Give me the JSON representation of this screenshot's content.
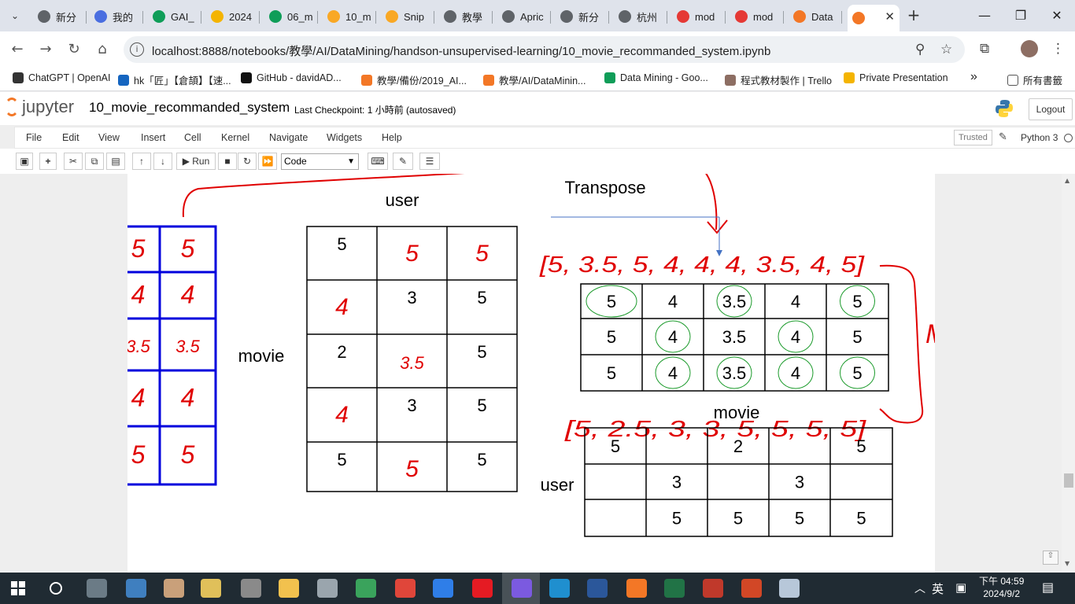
{
  "tabs": [
    {
      "label": "新分",
      "color": "#5f6368"
    },
    {
      "label": "我的",
      "color": "#4a6ee0"
    },
    {
      "label": "GAI_",
      "color": "#0f9d58"
    },
    {
      "label": "2024",
      "color": "#f4b400"
    },
    {
      "label": "06_m",
      "color": "#0f9d58"
    },
    {
      "label": "10_m",
      "color": "#f9a825"
    },
    {
      "label": "Snip",
      "color": "#f9a825"
    },
    {
      "label": "教學",
      "color": "#5f6368"
    },
    {
      "label": "Apric",
      "color": "#5f6368"
    },
    {
      "label": "新分",
      "color": "#5f6368"
    },
    {
      "label": "杭州",
      "color": "#5f6368"
    },
    {
      "label": "mod",
      "color": "#e53935"
    },
    {
      "label": "mod",
      "color": "#e53935"
    },
    {
      "label": "Data",
      "color": "#f37726"
    },
    {
      "label": "",
      "color": "#f37726"
    }
  ],
  "address": {
    "url": "localhost:8888/notebooks/教學/AI/DataMining/handson-unsupervised-learning/10_movie_recommanded_system.ipynb"
  },
  "bookmarks": [
    {
      "label": "ChatGPT | OpenAI",
      "color": "#333333"
    },
    {
      "label": "hk「匠」【倉頡】【速...",
      "color": "#1565c0"
    },
    {
      "label": "GitHub - davidAD...",
      "color": "#111111"
    },
    {
      "label": "教學/備份/2019_AI...",
      "color": "#f37726"
    },
    {
      "label": "教學/AI/DataMinin...",
      "color": "#f37726"
    },
    {
      "label": "Data Mining - Goo...",
      "color": "#0f9d58"
    },
    {
      "label": "程式教材製作 | Trello",
      "color": "#8d6e63"
    },
    {
      "label": "Private Presentation",
      "color": "#f4b400"
    }
  ],
  "bookmarks_all": "所有書籤",
  "jupyter": {
    "logo_text": "jupyter",
    "notebook_name": "10_movie_recommanded_system",
    "checkpoint": "Last Checkpoint: 1 小時前  (autosaved)",
    "logout": "Logout",
    "menu": [
      "File",
      "Edit",
      "View",
      "Insert",
      "Cell",
      "Kernel",
      "Navigate",
      "Widgets",
      "Help"
    ],
    "trusted": "Trusted",
    "kernel": "Python 3",
    "run_label": "Run",
    "cell_type": "Code"
  },
  "figure": {
    "user_top": "user",
    "movie_left": "movie",
    "transpose": "Transpose",
    "movie_mid": "movie",
    "user_left": "user",
    "mse": "MSE",
    "blue_grid": [
      [
        "5",
        "5",
        "5"
      ],
      [
        "4",
        "4",
        "4"
      ],
      [
        "3.5",
        "3.5",
        "3.5"
      ],
      [
        "4",
        "4",
        "4"
      ],
      [
        "5",
        "5",
        "5"
      ]
    ],
    "rating_cells": [
      {
        "text": "5",
        "style": "typed"
      },
      {
        "text": "5",
        "style": "hand"
      },
      {
        "text": "5",
        "style": "hand"
      },
      {
        "text": "4",
        "style": "hand"
      },
      {
        "text": "3",
        "style": "typed"
      },
      {
        "text": "5",
        "style": "typed"
      },
      {
        "text": "2",
        "style": "typed"
      },
      {
        "text": "3.5",
        "style": "hand"
      },
      {
        "text": "5",
        "style": "typed"
      },
      {
        "text": "4",
        "style": "hand"
      },
      {
        "text": "3",
        "style": "typed"
      },
      {
        "text": "5",
        "style": "typed"
      },
      {
        "text": "5",
        "style": "typed"
      },
      {
        "text": "5",
        "style": "hand"
      },
      {
        "text": "5",
        "style": "typed"
      }
    ],
    "top_vector": "[5, 3.5, 5, 4, 4, 4, 3.5, 4, 5]",
    "transposed": [
      [
        "5",
        "4",
        "3.5",
        "4",
        "5"
      ],
      [
        "5",
        "4",
        "3.5",
        "4",
        "5"
      ],
      [
        "5",
        "4",
        "3.5",
        "4",
        "5"
      ]
    ],
    "bottom_vector": "[5, 2.5, 3, 3, 5, 5, 5, 5]",
    "sparse": [
      [
        "5",
        "",
        "2",
        "",
        "5"
      ],
      [
        "",
        "3",
        "",
        "3",
        ""
      ],
      [
        "",
        "5",
        "5",
        "5",
        "5"
      ]
    ]
  },
  "taskbar": {
    "ime": "英",
    "time": "下午 04:59",
    "date": "2024/9/2"
  }
}
